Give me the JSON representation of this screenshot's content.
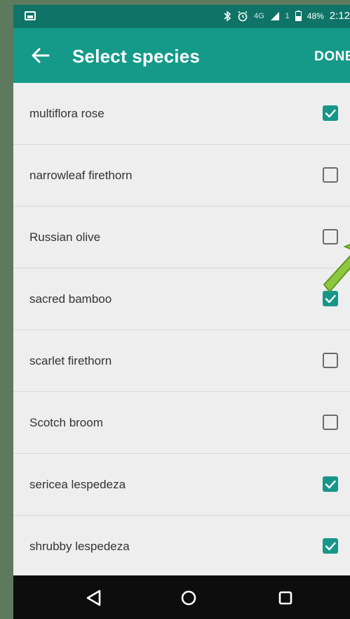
{
  "status_bar": {
    "network_text": "4G",
    "signal_text": "1",
    "battery": "48%",
    "time": "2:12"
  },
  "app_bar": {
    "title": "Select species",
    "action": "DONE"
  },
  "species": [
    {
      "name": "multiflora rose",
      "checked": true
    },
    {
      "name": "narrowleaf firethorn",
      "checked": false
    },
    {
      "name": "Russian olive",
      "checked": false
    },
    {
      "name": "sacred bamboo",
      "checked": true
    },
    {
      "name": "scarlet firethorn",
      "checked": false
    },
    {
      "name": "Scotch broom",
      "checked": false
    },
    {
      "name": "sericea lespedeza",
      "checked": true
    },
    {
      "name": "shrubby lespedeza",
      "checked": true
    }
  ],
  "colors": {
    "status_bar": "#0f7467",
    "app_bar": "#159a89",
    "checkbox_checked": "#17968a",
    "arrow": "#8dc63f"
  },
  "icons": {
    "back": "arrow-back-icon",
    "bluetooth": "bluetooth-icon",
    "alarm": "alarm-icon",
    "signal": "signal-icon",
    "battery": "battery-icon",
    "nav_back": "triangle-back-icon",
    "nav_home": "circle-home-icon",
    "nav_recents": "square-recents-icon"
  }
}
